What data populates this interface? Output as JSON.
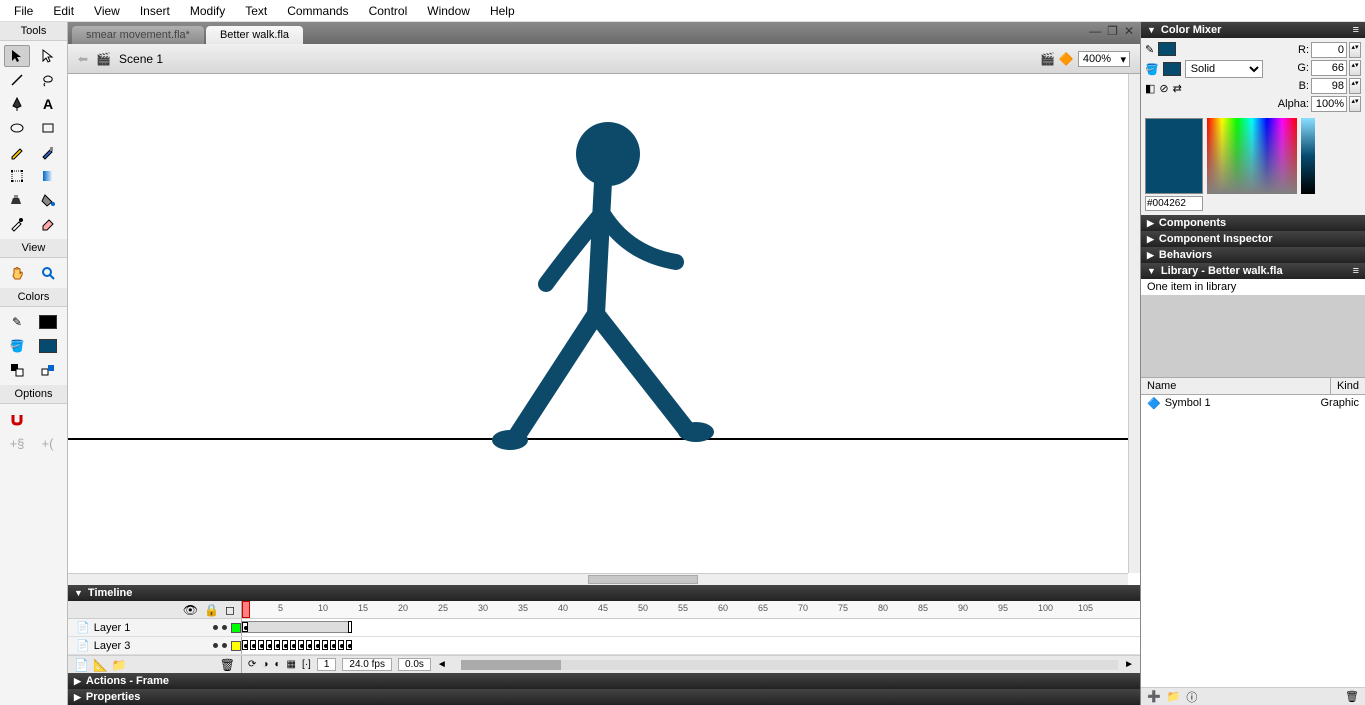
{
  "menu": [
    "File",
    "Edit",
    "View",
    "Insert",
    "Modify",
    "Text",
    "Commands",
    "Control",
    "Window",
    "Help"
  ],
  "tools": {
    "header": "Tools",
    "view_header": "View",
    "colors_header": "Colors",
    "options_header": "Options"
  },
  "tabs": [
    {
      "label": "smear movement.fla*",
      "active": false
    },
    {
      "label": "Better walk.fla",
      "active": true
    }
  ],
  "scene": {
    "label": "Scene 1",
    "zoom": "400%"
  },
  "timeline": {
    "title": "Timeline",
    "layers": [
      {
        "name": "Layer 1",
        "color": "#00ff00"
      },
      {
        "name": "Layer 3",
        "color": "#ffff00"
      }
    ],
    "ticks": [
      5,
      10,
      15,
      20,
      25,
      30,
      35,
      40,
      45,
      50,
      55,
      60,
      65,
      70,
      75,
      80,
      85,
      90,
      95,
      100,
      105
    ],
    "frame": "1",
    "fps": "24.0 fps",
    "time": "0.0s"
  },
  "actions_title": "Actions - Frame",
  "properties_title": "Properties",
  "mixer": {
    "title": "Color Mixer",
    "type": "Solid",
    "r": "0",
    "g": "66",
    "b": "98",
    "alpha": "100%",
    "hex": "#004262"
  },
  "panels": {
    "components": "Components",
    "inspector": "Component Inspector",
    "behaviors": "Behaviors"
  },
  "library": {
    "title": "Library - Better walk.fla",
    "info": "One item in library",
    "cols": {
      "name": "Name",
      "kind": "Kind"
    },
    "item": {
      "name": "Symbol 1",
      "kind": "Graphic"
    }
  },
  "stick_color": "#0d4a6a"
}
